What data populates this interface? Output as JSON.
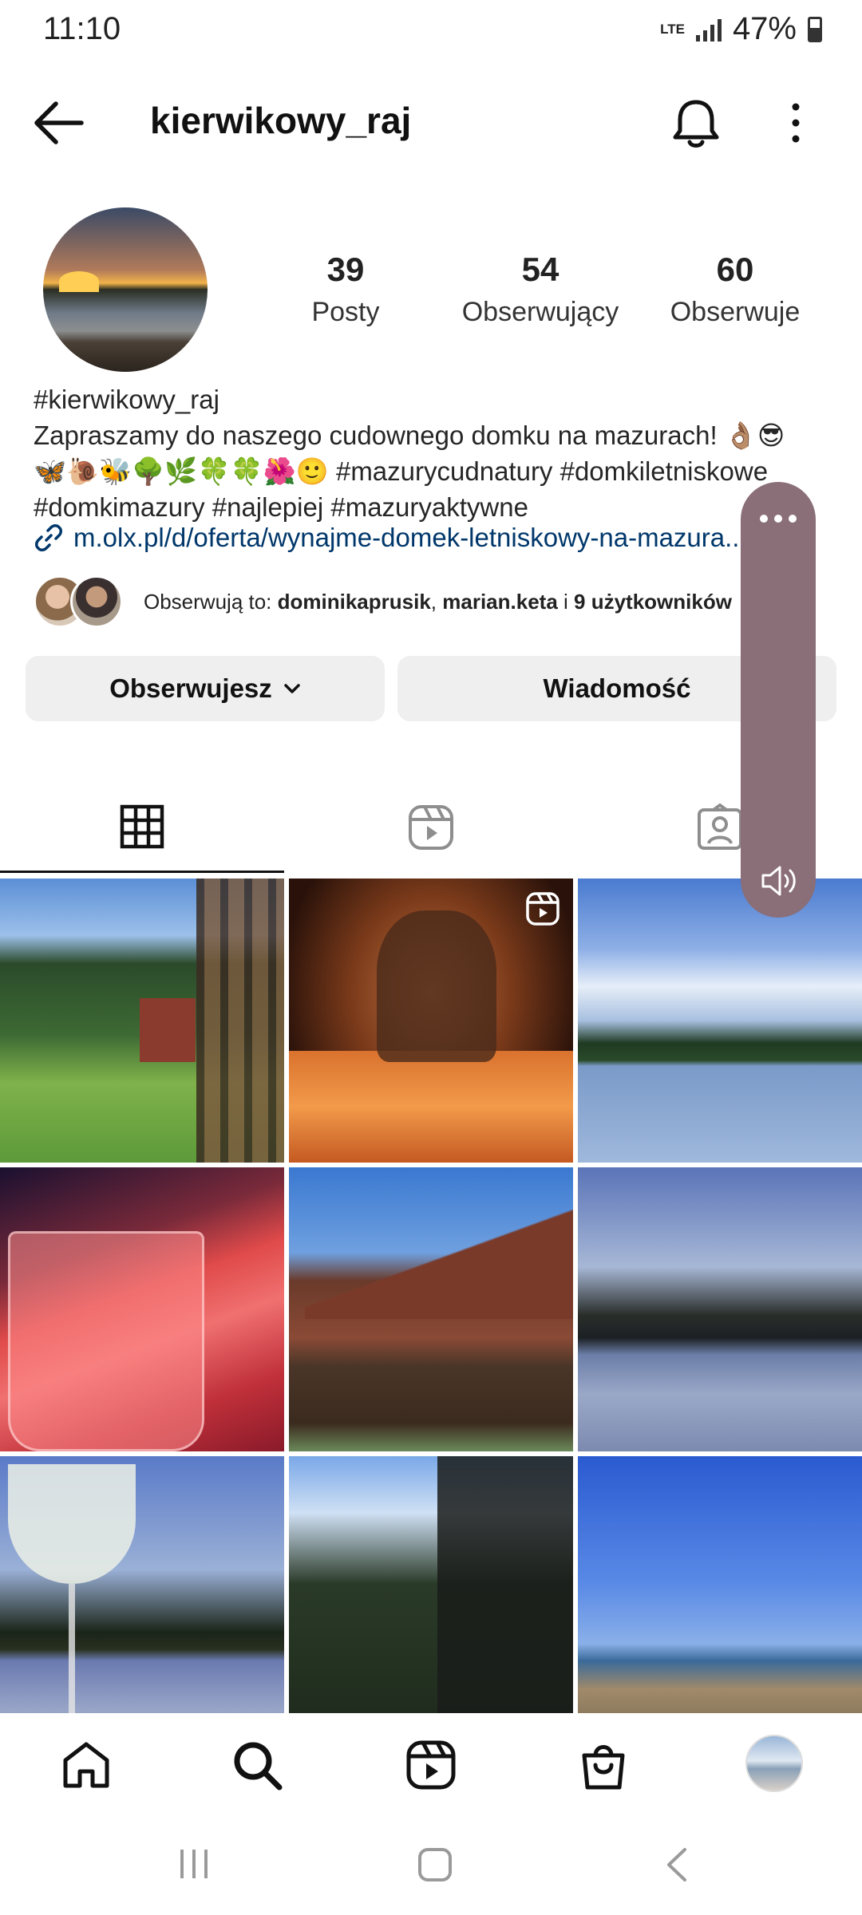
{
  "status_bar": {
    "time": "11:10",
    "network": "LTE",
    "battery": "47%"
  },
  "header": {
    "username": "kierwikowy_raj"
  },
  "stats": [
    {
      "value": "39",
      "label": "Posty"
    },
    {
      "value": "54",
      "label": "Obserwujący"
    },
    {
      "value": "60",
      "label": "Obserwuje"
    }
  ],
  "bio": {
    "name": "#kierwikowy_raj",
    "line1": "Zapraszamy do naszego cudownego domku na mazurach! 👌🏽😎",
    "line2": "🦋🐌🐝🌳🌿🍀🍀🌺🙂  #mazurycudnatury #domkiletniskowe",
    "line3": "#domkimazury #najlepiej #mazuryaktywne",
    "link": "m.olx.pl/d/oferta/wynajme-domek-letniskowy-na-mazura..."
  },
  "followed_by": {
    "prefix": "Obserwują to: ",
    "user1": "dominikaprusik",
    "sep": ", ",
    "user2": "marian.keta",
    "mid": " i ",
    "others": "9 użytkowników"
  },
  "buttons": {
    "follow": "Obserwujesz",
    "message": "Wiadomość"
  },
  "tabs": [
    "grid-tab",
    "reels-tab",
    "tagged-tab"
  ],
  "posts": [
    {
      "kind": "photo"
    },
    {
      "kind": "reel"
    },
    {
      "kind": "photo"
    },
    {
      "kind": "photo"
    },
    {
      "kind": "photo"
    },
    {
      "kind": "photo"
    },
    {
      "kind": "photo"
    },
    {
      "kind": "photo"
    },
    {
      "kind": "photo"
    }
  ],
  "colors": {
    "link": "#00376b",
    "button_bg": "#efefef",
    "overlay": "#8a6e78"
  }
}
